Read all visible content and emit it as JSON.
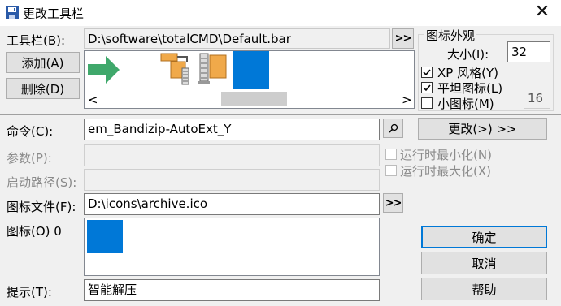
{
  "window": {
    "title": "更改工具栏",
    "close_glyph": "✕"
  },
  "toolbar": {
    "label": "工具栏(B):",
    "path": "D:\\software\\totalCMD\\Default.bar",
    "browse_label": ">>",
    "add_label": "添加(A)",
    "delete_label": "删除(D)",
    "scroll_left": "<",
    "scroll_right": ">"
  },
  "icon_appearance": {
    "group_label": "图标外观",
    "size_label": "大小(I):",
    "size_value": "32",
    "xp_style_label": "XP 风格(Y)",
    "xp_style_checked": true,
    "flat_icons_label": "平坦图标(L)",
    "flat_icons_checked": true,
    "small_icons_label": "小图标(M)",
    "small_icons_checked": false,
    "small_size_value": "16"
  },
  "button": {
    "command_label": "命令(C):",
    "command_value": "em_Bandizip-AutoExt_Y",
    "change_label": "更改(>) >>",
    "params_label": "参数(P):",
    "params_value": "",
    "start_path_label": "启动路径(S):",
    "start_path_value": "",
    "run_minimized_label": "运行时最小化(N)",
    "run_maximized_label": "运行时最大化(X)",
    "icon_file_label": "图标文件(F):",
    "icon_file_value": "D:\\icons\\archive.ico",
    "icon_file_browse": ">>",
    "icon_label": "图标(O) 0",
    "tooltip_label": "提示(T):",
    "tooltip_value": "智能解压"
  },
  "actions": {
    "ok_label": "确定",
    "cancel_label": "取消",
    "help_label": "帮助"
  },
  "colors": {
    "accent": "#0078d7",
    "arrow_green": "#3fa86b",
    "archive_orange": "#f0a94a"
  }
}
